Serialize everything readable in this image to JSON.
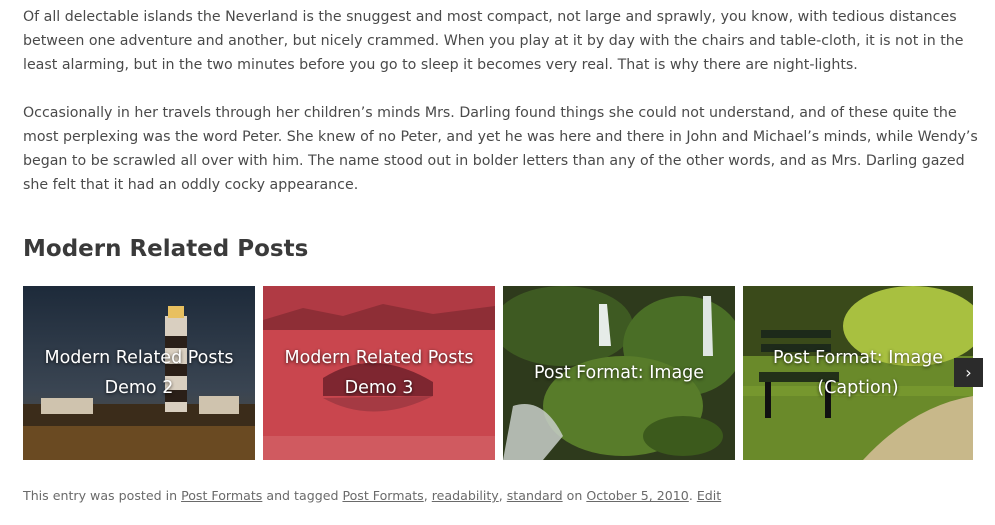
{
  "article": {
    "paragraph1": "Of all delectable islands the Neverland is the snuggest and most compact, not large and sprawly, you know, with tedious distances between one adventure and another, but nicely crammed. When you play at it by day with the chairs and table-cloth, it is not in the least alarming, but in the two minutes before you go to sleep it becomes very real. That is why there are night-lights.",
    "paragraph2": "Occasionally in her travels through her children’s minds Mrs. Darling found things she could not understand, and of these quite the most perplexing was the word Peter. She knew of no Peter, and yet he was here and there in John and Michael’s minds, while Wendy’s began to be scrawled all over with him. The name stood out in bolder letters than any of the other words, and as Mrs. Darling gazed she felt that it had an oddly cocky appearance."
  },
  "related": {
    "title": "Modern Related Posts",
    "posts": [
      {
        "label": "Modern Related Posts Demo 2",
        "image": "lighthouse-photo"
      },
      {
        "label": "Modern Related Posts Demo 3",
        "image": "crater-lake-red-photo"
      },
      {
        "label": "Post Format: Image",
        "image": "forest-waterfall-photo"
      },
      {
        "label": "Post Format: Image (Caption)",
        "image": "park-bench-photo"
      }
    ],
    "next_icon": "chevron-right-icon",
    "next_glyph": "›"
  },
  "footer": {
    "prefix": "This entry was posted in ",
    "category": "Post Formats",
    "tagged_text": " and tagged ",
    "tags": [
      "Post Formats",
      "readability",
      "standard"
    ],
    "sep": ", ",
    "on_text": " on ",
    "date": "October 5, 2010",
    "period": ". ",
    "edit": "Edit"
  }
}
